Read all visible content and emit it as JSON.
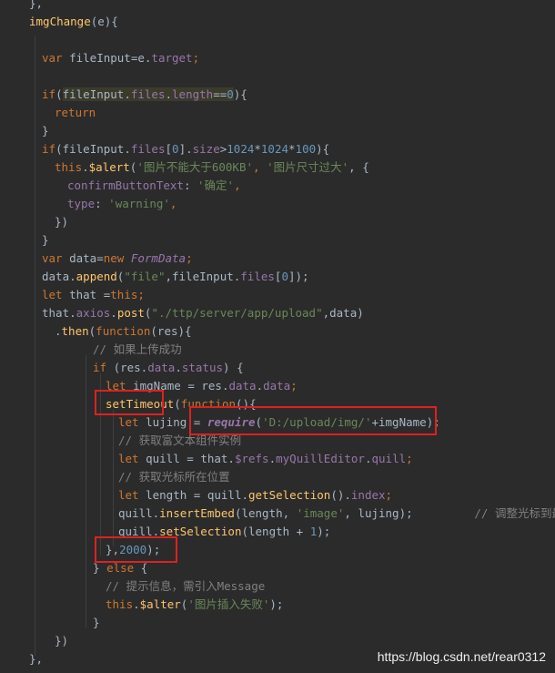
{
  "editor": {
    "lines": [
      {
        "tokens": [
          {
            "t": "},",
            "c": "plain"
          }
        ]
      },
      {
        "tokens": [
          {
            "t": "imgChange",
            "c": "fn"
          },
          {
            "t": "(e){",
            "c": "plain"
          }
        ]
      },
      {
        "tokens": []
      },
      {
        "tokens": [
          {
            "t": "var",
            "c": "kw"
          },
          {
            "t": " fileInput=e.",
            "c": "plain"
          },
          {
            "t": "target",
            "c": "prop"
          },
          {
            "t": ";",
            "c": "kw"
          }
        ]
      },
      {
        "tokens": []
      },
      {
        "tokens": [
          {
            "t": "if",
            "c": "kw"
          },
          {
            "t": "(",
            "c": "plain"
          },
          {
            "t": "fileInput.",
            "c": "plain",
            "hl": true
          },
          {
            "t": "files",
            "c": "prop",
            "hl": true
          },
          {
            "t": ".",
            "c": "plain",
            "hl": true
          },
          {
            "t": "length",
            "c": "prop",
            "hl": true
          },
          {
            "t": "==",
            "c": "plain",
            "hl": true
          },
          {
            "t": "0",
            "c": "num",
            "hl": true
          },
          {
            "t": "){",
            "c": "plain"
          }
        ]
      },
      {
        "tokens": [
          {
            "t": "return",
            "c": "kw"
          }
        ]
      },
      {
        "tokens": [
          {
            "t": "}",
            "c": "plain"
          }
        ]
      },
      {
        "tokens": [
          {
            "t": "if",
            "c": "kw"
          },
          {
            "t": "(fileInput.",
            "c": "plain"
          },
          {
            "t": "files",
            "c": "prop"
          },
          {
            "t": "[",
            "c": "plain"
          },
          {
            "t": "0",
            "c": "num"
          },
          {
            "t": "].",
            "c": "plain"
          },
          {
            "t": "size",
            "c": "prop"
          },
          {
            "t": ">",
            "c": "plain"
          },
          {
            "t": "1024",
            "c": "num"
          },
          {
            "t": "*",
            "c": "plain"
          },
          {
            "t": "1024",
            "c": "num"
          },
          {
            "t": "*",
            "c": "plain"
          },
          {
            "t": "100",
            "c": "num"
          },
          {
            "t": "){",
            "c": "plain"
          }
        ]
      },
      {
        "tokens": [
          {
            "t": "this",
            "c": "kw"
          },
          {
            "t": ".",
            "c": "plain"
          },
          {
            "t": "$alert",
            "c": "fn"
          },
          {
            "t": "(",
            "c": "plain"
          },
          {
            "t": "'图片不能大于600KB'",
            "c": "str"
          },
          {
            "t": ", ",
            "c": "kw"
          },
          {
            "t": "'图片尺寸过大'",
            "c": "str"
          },
          {
            "t": ", {",
            "c": "plain"
          }
        ]
      },
      {
        "tokens": [
          {
            "t": "confirmButtonText",
            "c": "prop"
          },
          {
            "t": ": ",
            "c": "plain"
          },
          {
            "t": "'确定'",
            "c": "str"
          },
          {
            "t": ",",
            "c": "kw"
          }
        ]
      },
      {
        "tokens": [
          {
            "t": "type",
            "c": "prop"
          },
          {
            "t": ": ",
            "c": "plain"
          },
          {
            "t": "'warning'",
            "c": "str"
          },
          {
            "t": ",",
            "c": "kw"
          }
        ]
      },
      {
        "tokens": [
          {
            "t": "})",
            "c": "plain"
          }
        ]
      },
      {
        "tokens": [
          {
            "t": "}",
            "c": "plain"
          }
        ]
      },
      {
        "tokens": [
          {
            "t": "var",
            "c": "kw"
          },
          {
            "t": " data=",
            "c": "plain"
          },
          {
            "t": "new ",
            "c": "kw"
          },
          {
            "t": "FormData",
            "c": "cls"
          },
          {
            "t": ";",
            "c": "kw"
          }
        ]
      },
      {
        "tokens": [
          {
            "t": "data.",
            "c": "plain"
          },
          {
            "t": "append",
            "c": "fn"
          },
          {
            "t": "(",
            "c": "plain"
          },
          {
            "t": "\"file\"",
            "c": "str"
          },
          {
            "t": ",fileInput.",
            "c": "plain"
          },
          {
            "t": "files",
            "c": "prop"
          },
          {
            "t": "[",
            "c": "plain"
          },
          {
            "t": "0",
            "c": "num"
          },
          {
            "t": "]);",
            "c": "plain"
          }
        ]
      },
      {
        "tokens": [
          {
            "t": "let ",
            "c": "kw"
          },
          {
            "t": "that =",
            "c": "plain"
          },
          {
            "t": "this",
            "c": "kw"
          },
          {
            "t": ";",
            "c": "kw"
          }
        ]
      },
      {
        "tokens": [
          {
            "t": "that.",
            "c": "plain"
          },
          {
            "t": "axios",
            "c": "prop"
          },
          {
            "t": ".",
            "c": "plain"
          },
          {
            "t": "post",
            "c": "fn"
          },
          {
            "t": "(",
            "c": "plain"
          },
          {
            "t": "\"./ttp/server/app/upload\"",
            "c": "str"
          },
          {
            "t": ",data)",
            "c": "plain"
          }
        ]
      },
      {
        "tokens": [
          {
            "t": ".",
            "c": "plain"
          },
          {
            "t": "then",
            "c": "fn"
          },
          {
            "t": "(",
            "c": "plain"
          },
          {
            "t": "function",
            "c": "kw"
          },
          {
            "t": "(res){",
            "c": "plain"
          }
        ]
      },
      {
        "tokens": [
          {
            "t": "// 如果上传成功",
            "c": "cmt"
          }
        ]
      },
      {
        "tokens": [
          {
            "t": "if ",
            "c": "kw"
          },
          {
            "t": "(res.",
            "c": "plain"
          },
          {
            "t": "data",
            "c": "prop"
          },
          {
            "t": ".",
            "c": "plain"
          },
          {
            "t": "status",
            "c": "prop"
          },
          {
            "t": ") {",
            "c": "plain"
          }
        ]
      },
      {
        "tokens": [
          {
            "t": "let ",
            "c": "kw"
          },
          {
            "t": "imgName = res.",
            "c": "plain"
          },
          {
            "t": "data",
            "c": "prop"
          },
          {
            "t": ".",
            "c": "plain"
          },
          {
            "t": "data",
            "c": "prop"
          },
          {
            "t": ";",
            "c": "kw"
          }
        ]
      },
      {
        "tokens": [
          {
            "t": "setTimeout",
            "c": "fn"
          },
          {
            "t": "(",
            "c": "plain"
          },
          {
            "t": "function",
            "c": "kw"
          },
          {
            "t": "(){",
            "c": "plain"
          }
        ]
      },
      {
        "tokens": [
          {
            "t": "let ",
            "c": "kw"
          },
          {
            "t": "lujing = ",
            "c": "plain"
          },
          {
            "t": "require",
            "c": "req"
          },
          {
            "t": "(",
            "c": "plain"
          },
          {
            "t": "'D:/upload/img/'",
            "c": "str"
          },
          {
            "t": "+imgName);",
            "c": "plain"
          }
        ]
      },
      {
        "tokens": [
          {
            "t": "// 获取富文本组件实例",
            "c": "cmt"
          }
        ]
      },
      {
        "tokens": [
          {
            "t": "let ",
            "c": "kw"
          },
          {
            "t": "quill = that.",
            "c": "plain"
          },
          {
            "t": "$refs",
            "c": "prop"
          },
          {
            "t": ".",
            "c": "plain"
          },
          {
            "t": "myQuillEditor",
            "c": "prop"
          },
          {
            "t": ".",
            "c": "plain"
          },
          {
            "t": "quill",
            "c": "prop"
          },
          {
            "t": ";",
            "c": "kw"
          }
        ]
      },
      {
        "tokens": [
          {
            "t": "// 获取光标所在位置",
            "c": "cmt"
          }
        ]
      },
      {
        "tokens": [
          {
            "t": "let ",
            "c": "kw"
          },
          {
            "t": "length = quill.",
            "c": "plain"
          },
          {
            "t": "getSelection",
            "c": "fn"
          },
          {
            "t": "().",
            "c": "plain"
          },
          {
            "t": "index",
            "c": "prop"
          },
          {
            "t": ";",
            "c": "kw"
          }
        ]
      },
      {
        "tokens": [
          {
            "t": "quill.",
            "c": "plain"
          },
          {
            "t": "insertEmbed",
            "c": "fn"
          },
          {
            "t": "(length, ",
            "c": "plain"
          },
          {
            "t": "'image'",
            "c": "str"
          },
          {
            "t": ", lujing);         ",
            "c": "plain"
          },
          {
            "t": "// 调整光标到最后",
            "c": "cmt"
          }
        ]
      },
      {
        "tokens": [
          {
            "t": "quill.",
            "c": "plain"
          },
          {
            "t": "setSelection",
            "c": "fn"
          },
          {
            "t": "(length + ",
            "c": "plain"
          },
          {
            "t": "1",
            "c": "num"
          },
          {
            "t": ");",
            "c": "plain"
          }
        ]
      },
      {
        "tokens": [
          {
            "t": "},",
            "c": "plain"
          },
          {
            "t": "2000",
            "c": "num"
          },
          {
            "t": ");",
            "c": "plain"
          }
        ]
      },
      {
        "tokens": [
          {
            "t": "} ",
            "c": "plain"
          },
          {
            "t": "else ",
            "c": "kw"
          },
          {
            "t": "{",
            "c": "plain"
          }
        ]
      },
      {
        "tokens": [
          {
            "t": "// 提示信息，需引入Message",
            "c": "cmt"
          }
        ]
      },
      {
        "tokens": [
          {
            "t": "this",
            "c": "kw"
          },
          {
            "t": ".",
            "c": "plain"
          },
          {
            "t": "$alter",
            "c": "fn"
          },
          {
            "t": "(",
            "c": "plain"
          },
          {
            "t": "'图片插入失败'",
            "c": "str"
          },
          {
            "t": ");",
            "c": "plain"
          }
        ]
      },
      {
        "tokens": [
          {
            "t": "}",
            "c": "plain"
          }
        ]
      },
      {
        "tokens": [
          {
            "t": "})",
            "c": "plain"
          }
        ]
      },
      {
        "tokens": [
          {
            "t": "},",
            "c": "plain"
          }
        ]
      }
    ]
  },
  "watermark": "https://blog.csdn.net/rear0312",
  "colors": {
    "background": "#2b2b2b",
    "keyword": "#cc7832",
    "function": "#ffc66d",
    "property": "#9876aa",
    "string": "#6a8759",
    "number": "#6897bb",
    "comment": "#808080",
    "annotation_box": "#e02020"
  }
}
